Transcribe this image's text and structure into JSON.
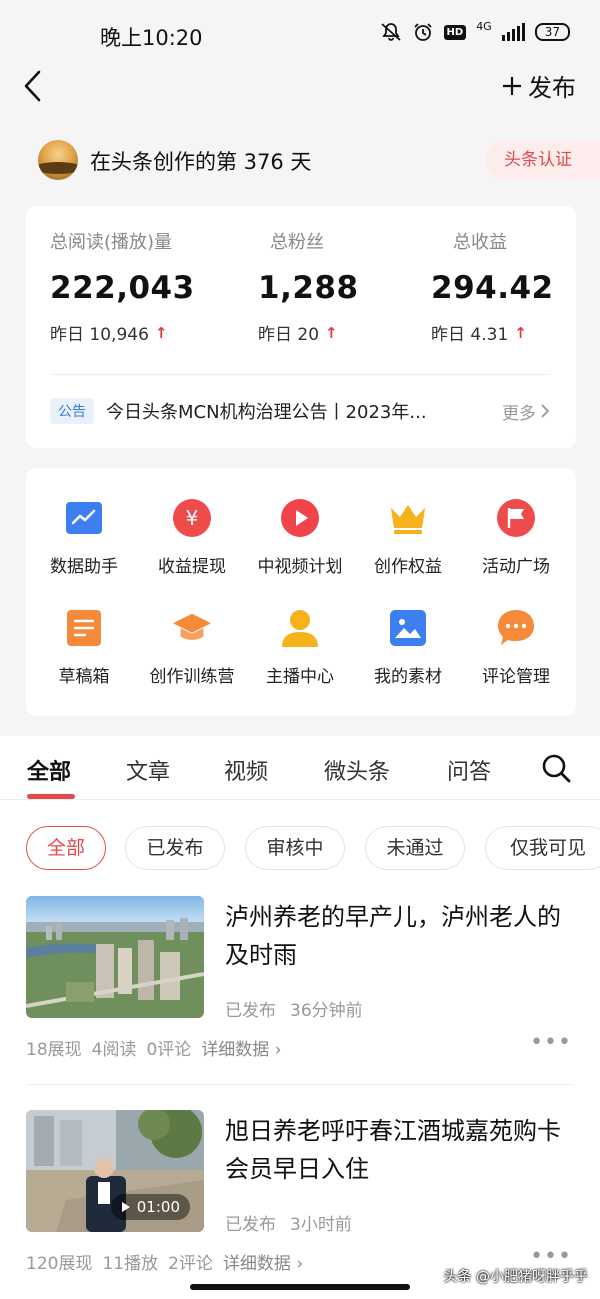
{
  "status_bar": {
    "time": "晚上10:20",
    "network": "4G",
    "hd_label": "HD",
    "battery": "37"
  },
  "topbar": {
    "publish_label": "发布"
  },
  "creator": {
    "text": "在头条创作的第 376 天",
    "badge": "头条认证"
  },
  "stats": [
    {
      "label": "总阅读(播放)量",
      "value": "222,043",
      "delta": "昨日 10,946"
    },
    {
      "label": "总粉丝",
      "value": "1,288",
      "delta": "昨日 20"
    },
    {
      "label": "总收益",
      "value": "294.42",
      "delta": "昨日 4.31"
    }
  ],
  "notice": {
    "tag": "公告",
    "text": "今日头条MCN机构治理公告丨2023年...",
    "more": "更多"
  },
  "tools": [
    {
      "label": "数据助手",
      "icon": "chart-icon",
      "color": "#3d7ff0"
    },
    {
      "label": "收益提现",
      "icon": "yuan-icon",
      "color": "#ee4b4b"
    },
    {
      "label": "中视频计划",
      "icon": "play-icon",
      "color": "#f0434a"
    },
    {
      "label": "创作权益",
      "icon": "crown-icon",
      "color": "#f5b21b"
    },
    {
      "label": "活动广场",
      "icon": "flag-icon",
      "color": "#ee4b4b"
    },
    {
      "label": "草稿箱",
      "icon": "draft-icon",
      "color": "#f58a3a"
    },
    {
      "label": "创作训练营",
      "icon": "graduation-cap-icon",
      "color": "#f58a3a"
    },
    {
      "label": "主播中心",
      "icon": "person-icon",
      "color": "#f5b21b"
    },
    {
      "label": "我的素材",
      "icon": "image-icon",
      "color": "#3d7ff0"
    },
    {
      "label": "评论管理",
      "icon": "comment-icon",
      "color": "#f58a3a"
    }
  ],
  "tabs": [
    "全部",
    "文章",
    "视频",
    "微头条",
    "问答"
  ],
  "filters": [
    "全部",
    "已发布",
    "审核中",
    "未通过",
    "仅我可见"
  ],
  "articles": [
    {
      "title": "泸州养老的早产儿，泸州老人的及时雨",
      "status": "已发布",
      "time": "36分钟前",
      "impressions": "18展现",
      "reads": "4阅读",
      "comments": "0评论",
      "detail": "详细数据"
    },
    {
      "title": "旭日养老呼吁春江酒城嘉苑购卡会员早日入住",
      "status": "已发布",
      "time": "3小时前",
      "impressions": "120展现",
      "reads": "11播放",
      "comments": "2评论",
      "detail": "详细数据",
      "duration": "01:00"
    }
  ],
  "watermark": "头条 @小肥猪呀胖乎乎",
  "colors": {
    "accent": "#e5494d",
    "up_arrow": "#e23b3b",
    "notice_tag": "#3a7bd5"
  }
}
